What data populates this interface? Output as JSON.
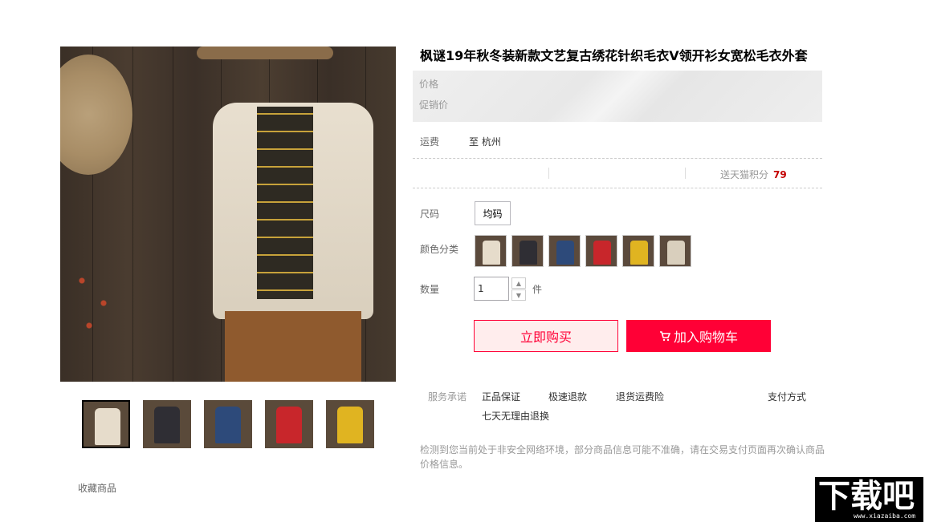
{
  "product": {
    "title": "枫谜19年秋冬装新款文艺复古绣花针织毛衣V领开衫女宽松毛衣外套"
  },
  "price": {
    "price_label": "价格",
    "promo_label": "促销价"
  },
  "shipping": {
    "label": "运费",
    "value": "至 杭州"
  },
  "points": {
    "label": "送天猫积分",
    "value": "79"
  },
  "size": {
    "label": "尺码",
    "options": [
      "均码"
    ]
  },
  "color": {
    "label": "颜色分类",
    "swatches": [
      "#e6dccb",
      "#2f2e34",
      "#2d4a7a",
      "#c8262b",
      "#e0b421",
      "#d9cfbd"
    ]
  },
  "quantity": {
    "label": "数量",
    "value": "1",
    "unit": "件"
  },
  "actions": {
    "buy_now": "立即购买",
    "add_to_cart": "加入购物车"
  },
  "service": {
    "label": "服务承诺",
    "items": [
      "正品保证",
      "极速退款",
      "退货运费险",
      "七天无理由退换"
    ],
    "payment": "支付方式"
  },
  "notice": "检测到您当前处于非安全网络环境，部分商品信息可能不准确，请在交易支付页面再次确认商品价格信息。",
  "favorite": "收藏商品",
  "thumbnails": [
    "#e6dccb",
    "#2f2e34",
    "#2d4a7a",
    "#c8262b",
    "#e0b421"
  ],
  "watermark": {
    "text": "下载吧",
    "url": "www.xiazaiba.com"
  },
  "colors": {
    "accent": "#ff0036",
    "points": "#c40000"
  }
}
